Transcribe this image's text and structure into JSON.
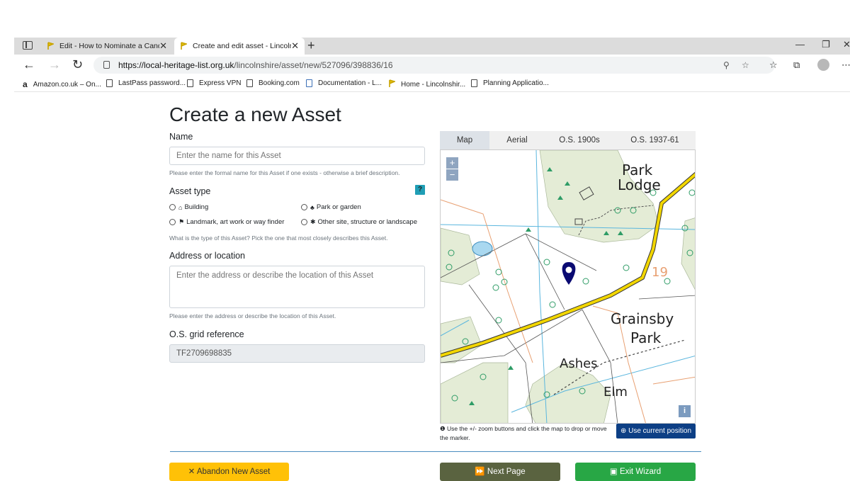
{
  "browser": {
    "tabs": [
      {
        "label": "Edit - How to Nominate a Candi"
      },
      {
        "label": "Create and edit asset - Lincolnsh"
      }
    ],
    "url_host": "https://local-heritage-list.org.uk",
    "url_path": "/lincolnshire/asset/new/527096/398836/16",
    "bookmarks": [
      {
        "label": "Amazon.co.uk – On..."
      },
      {
        "label": "LastPass password..."
      },
      {
        "label": "Express VPN"
      },
      {
        "label": "Booking.com"
      },
      {
        "label": "Documentation - L..."
      },
      {
        "label": "Home - Lincolnshir..."
      },
      {
        "label": "Planning Applicatio..."
      }
    ]
  },
  "form": {
    "title": "Create a new Asset",
    "name_label": "Name",
    "name_placeholder": "Enter the name for this Asset",
    "name_help": "Please enter the formal name for this Asset if one exists - otherwise a brief description.",
    "asset_type_label": "Asset type",
    "asset_type_help_icon": "?",
    "asset_types": [
      {
        "label": "Building",
        "icon": "home-icon"
      },
      {
        "label": "Park or garden",
        "icon": "tree-icon"
      },
      {
        "label": "Landmark, art work or way finder",
        "icon": "flag-icon"
      },
      {
        "label": "Other site, structure or landscape",
        "icon": "asterisk-icon"
      }
    ],
    "asset_type_help": "What is the type of this Asset? Pick the one that most closely describes this Asset.",
    "address_label": "Address or location",
    "address_placeholder": "Enter the address or describe the location of this Asset",
    "address_help": "Please enter the address or describe the location of this Asset.",
    "grid_label": "O.S. grid reference",
    "grid_value": "TF2709698835"
  },
  "map": {
    "tabs": [
      "Map",
      "Aerial",
      "O.S. 1900s",
      "O.S. 1937-61"
    ],
    "active_tab": "Map",
    "zoom_in": "+",
    "zoom_out": "−",
    "info_btn": "i",
    "labels": {
      "park_lodge_1": "Park",
      "park_lodge_2": "Lodge",
      "grainsby_1": "Grainsby",
      "grainsby_2": "Park",
      "ashes": "Ashes",
      "elm": "Elm",
      "number": "19"
    },
    "note": "Use the +/- zoom buttons and click the map to drop or move the marker.",
    "use_position": "Use current position"
  },
  "buttons": {
    "abandon": "Abandon New Asset",
    "next": "Next Page",
    "exit": "Exit Wizard"
  },
  "colors": {
    "accent_blue": "#0d3f85",
    "abandon": "#ffc107",
    "next": "#5a6340",
    "exit": "#28a745",
    "road": "#f2d600"
  }
}
